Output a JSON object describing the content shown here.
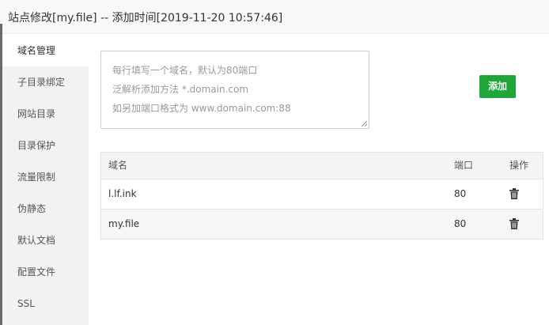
{
  "title": "站点修改[my.file] -- 添加时间[2019-11-20 10:57:46]",
  "sidebar": {
    "items": [
      {
        "label": "域名管理"
      },
      {
        "label": "子目录绑定"
      },
      {
        "label": "网站目录"
      },
      {
        "label": "目录保护"
      },
      {
        "label": "流量限制"
      },
      {
        "label": "伪静态"
      },
      {
        "label": "默认文档"
      },
      {
        "label": "配置文件"
      },
      {
        "label": "SSL"
      }
    ]
  },
  "domain_input": {
    "placeholder_lines": [
      "每行填写一个域名，默认为80端口",
      "泛解析添加方法 *.domain.com",
      "如另加端口格式为 www.domain.com:88"
    ]
  },
  "add_button": {
    "label": "添加"
  },
  "table": {
    "headers": {
      "domain": "域名",
      "port": "端口",
      "action": "操作"
    },
    "rows": [
      {
        "domain": "l.lf.ink",
        "port": "80"
      },
      {
        "domain": "my.file",
        "port": "80"
      }
    ]
  },
  "colors": {
    "accent": "#20a53a"
  }
}
